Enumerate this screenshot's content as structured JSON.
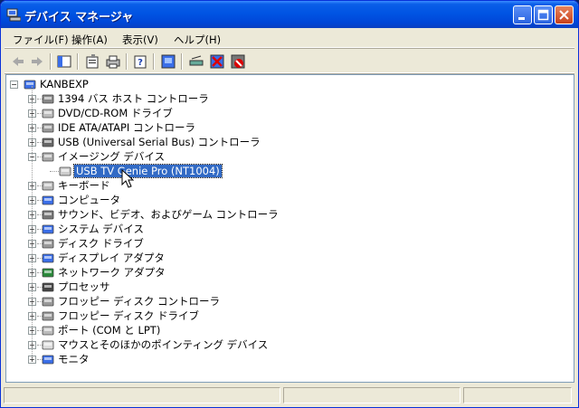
{
  "window": {
    "title": "デバイス マネージャ",
    "accent": "#0054e3"
  },
  "menu": [
    {
      "label": "ファイル(F)"
    },
    {
      "label": "操作(A)"
    },
    {
      "label": "表示(V)"
    },
    {
      "label": "ヘルプ(H)"
    }
  ],
  "toolbar": [
    {
      "icon": "back-arrow-icon"
    },
    {
      "icon": "forward-arrow-icon"
    },
    {
      "icon": "show-hide-console-tree-icon"
    },
    {
      "icon": "properties-icon"
    },
    {
      "icon": "print-icon"
    },
    {
      "icon": "help-icon"
    },
    {
      "icon": "update-driver-icon"
    },
    {
      "icon": "scan-hardware-icon"
    },
    {
      "icon": "uninstall-icon"
    },
    {
      "icon": "disable-device-icon"
    }
  ],
  "tree": {
    "root": {
      "label": "KANBEXP",
      "icon": "computer-icon"
    },
    "items": [
      {
        "label": "1394 バス ホスト コントローラ",
        "icon": "1394-controller-icon",
        "expanded": false
      },
      {
        "label": "DVD/CD-ROM ドライブ",
        "icon": "cdrom-icon",
        "expanded": false
      },
      {
        "label": "IDE ATA/ATAPI コントローラ",
        "icon": "ide-controller-icon",
        "expanded": false
      },
      {
        "label": "USB (Universal Serial Bus) コントローラ",
        "icon": "usb-icon",
        "expanded": false
      },
      {
        "label": "イメージング デバイス",
        "icon": "imaging-device-icon",
        "expanded": true,
        "children": [
          {
            "label": "USB TV Genie Pro (NT1004)",
            "icon": "camera-icon",
            "selected": true
          }
        ]
      },
      {
        "label": "キーボード",
        "icon": "keyboard-icon",
        "expanded": false
      },
      {
        "label": "コンピュータ",
        "icon": "computer-icon",
        "expanded": false
      },
      {
        "label": "サウンド、ビデオ、およびゲーム コントローラ",
        "icon": "sound-icon",
        "expanded": false
      },
      {
        "label": "システム デバイス",
        "icon": "system-device-icon",
        "expanded": false
      },
      {
        "label": "ディスク ドライブ",
        "icon": "disk-drive-icon",
        "expanded": false
      },
      {
        "label": "ディスプレイ アダプタ",
        "icon": "display-adapter-icon",
        "expanded": false
      },
      {
        "label": "ネットワーク アダプタ",
        "icon": "network-adapter-icon",
        "expanded": false
      },
      {
        "label": "プロセッサ",
        "icon": "processor-icon",
        "expanded": false
      },
      {
        "label": "フロッピー ディスク コントローラ",
        "icon": "floppy-controller-icon",
        "expanded": false
      },
      {
        "label": "フロッピー ディスク ドライブ",
        "icon": "floppy-drive-icon",
        "expanded": false
      },
      {
        "label": "ポート (COM と LPT)",
        "icon": "port-icon",
        "expanded": false
      },
      {
        "label": "マウスとそのほかのポインティング デバイス",
        "icon": "mouse-icon",
        "expanded": false
      },
      {
        "label": "モニタ",
        "icon": "monitor-icon",
        "expanded": false
      }
    ]
  },
  "status": {
    "cells": [
      "",
      "",
      ""
    ]
  }
}
